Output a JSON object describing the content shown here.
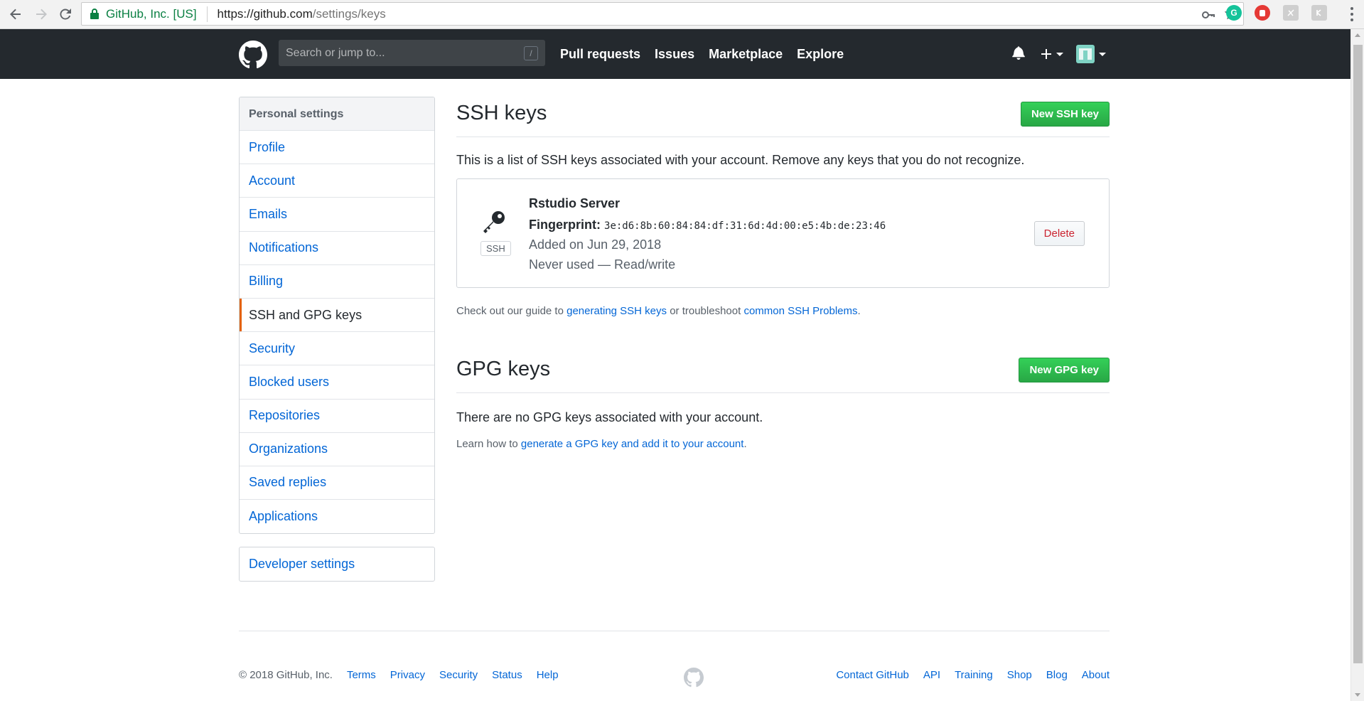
{
  "browser": {
    "secure_label": "GitHub, Inc. [US]",
    "url_host": "https://github.com",
    "url_path": "/settings/keys"
  },
  "header": {
    "search_placeholder": "Search or jump to...",
    "search_shortcut": "/",
    "nav": [
      "Pull requests",
      "Issues",
      "Marketplace",
      "Explore"
    ]
  },
  "sidebar": {
    "heading": "Personal settings",
    "items": [
      {
        "label": "Profile"
      },
      {
        "label": "Account"
      },
      {
        "label": "Emails"
      },
      {
        "label": "Notifications"
      },
      {
        "label": "Billing"
      },
      {
        "label": "SSH and GPG keys",
        "selected": true
      },
      {
        "label": "Security"
      },
      {
        "label": "Blocked users"
      },
      {
        "label": "Repositories"
      },
      {
        "label": "Organizations"
      },
      {
        "label": "Saved replies"
      },
      {
        "label": "Applications"
      }
    ],
    "developer_settings": "Developer settings"
  },
  "ssh": {
    "title": "SSH keys",
    "new_button": "New SSH key",
    "lead": "This is a list of SSH keys associated with your account. Remove any keys that you do not recognize.",
    "key": {
      "type_label": "SSH",
      "name": "Rstudio Server",
      "fingerprint_label": "Fingerprint:",
      "fingerprint": "3e:d6:8b:60:84:84:df:31:6d:4d:00:e5:4b:de:23:46",
      "added": "Added on Jun 29, 2018",
      "usage": "Never used — Read/write",
      "delete_label": "Delete"
    },
    "guide_prefix": "Check out our guide to",
    "guide_link1": "generating SSH keys",
    "guide_middle": "or troubleshoot",
    "guide_link2": "common SSH Problems",
    "guide_suffix": "."
  },
  "gpg": {
    "title": "GPG keys",
    "new_button": "New GPG key",
    "lead": "There are no GPG keys associated with your account.",
    "learn_prefix": "Learn how to",
    "learn_link": "generate a GPG key and add it to your account",
    "learn_suffix": "."
  },
  "footer": {
    "copyright": "© 2018 GitHub, Inc.",
    "left_links": [
      "Terms",
      "Privacy",
      "Security",
      "Status",
      "Help"
    ],
    "right_links": [
      "Contact GitHub",
      "API",
      "Training",
      "Shop",
      "Blog",
      "About"
    ]
  },
  "colors": {
    "header_bg": "#24292e",
    "link": "#0366d6",
    "green_button": "#28a745",
    "selected_accent": "#e36209",
    "delete_text": "#cb2431"
  }
}
